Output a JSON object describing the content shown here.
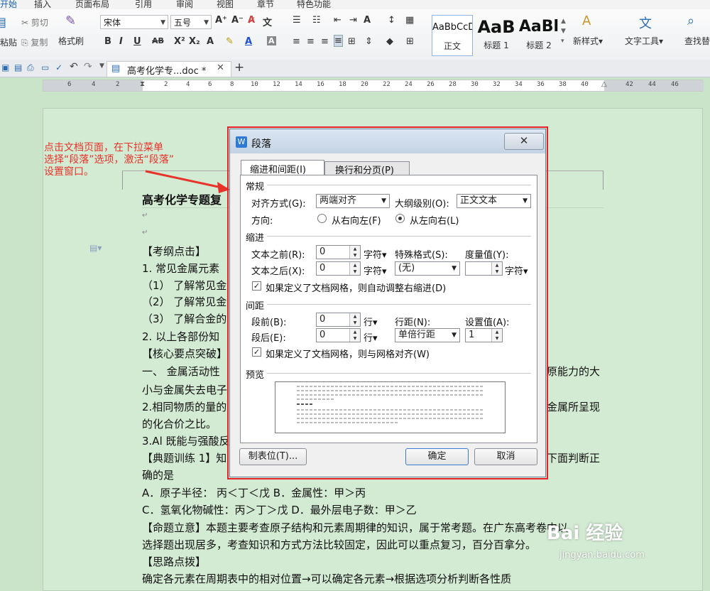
{
  "menu_tabs": [
    "开始",
    "插入",
    "页面布局",
    "引用",
    "审阅",
    "视图",
    "章节",
    "特色功能"
  ],
  "ribbon": {
    "paste": "粘贴",
    "cut": "剪切",
    "copy": "复制",
    "format_painter": "格式刷",
    "font": "宋体",
    "font_size": "五号",
    "style_previews": [
      {
        "preview": "AaBbCcDd",
        "label": "正文"
      },
      {
        "preview": "AaB",
        "label": "标题 1"
      },
      {
        "preview": "AaBl",
        "label": "标题 2"
      }
    ],
    "new_style": "新样式",
    "text_tools": "文字工具",
    "find": "查找替"
  },
  "doc_tab": {
    "title": "高考化学专...doc *"
  },
  "ruler_numbers": [
    "6",
    "4",
    "2",
    "2",
    "4",
    "6",
    "8",
    "10",
    "12",
    "14",
    "16",
    "18",
    "20",
    "22",
    "24",
    "26",
    "28",
    "30",
    "32",
    "34",
    "36",
    "38",
    "40",
    "42",
    "44",
    "46"
  ],
  "annotation": "点击文档页面，在下拉菜单\n选择“段落”选项，激活“段落”\n设置窗口。",
  "document_lines": [
    "高考化学专题复",
    "",
    "",
    "【考纲点击】",
    "1. 常见金属元素",
    "（1）  了解常见金",
    "（2）  了解常见金",
    "（3）  了解合金的",
    "2. 以上各部份知",
    "【核心要点突破】",
    "一、  金属活动性",
    "小与金属失去电子",
    "2.相同物质的量的",
    "的化合价之比。",
    "3.Al 既能与强酸反",
    "【典题训练 1】知",
    "确的是",
    "A．原子半径：  丙＜丁＜戊               B．金属性：甲＞丙",
    "C．氢氧化物碱性：丙＞丁＞戊             D．最外层电子数：甲＞乙",
    "【命题立意】本题主要考查原子结构和元素周期律的知识，属于常考题。在广东高考卷中以",
    "选择题出现居多，考查知识和方式方法比较固定，因此可以重点复习，百分百拿分。",
    "【思路点拨】",
    "    确定各元素在周期表中的相对位置→可以确定各元素→根据选项分析判断各性质"
  ],
  "right_fragments": [
    "原能力的大",
    "金属所呈现",
    "下面判断正"
  ],
  "dialog": {
    "title": "段落",
    "tabs": [
      "缩进和间距(I)",
      "换行和分页(P)"
    ],
    "sec_general": "常规",
    "align_label": "对齐方式(G):",
    "align_value": "两端对齐",
    "outline_label": "大纲级别(O):",
    "outline_value": "正文文本",
    "direction_label": "方向:",
    "dir_rtl": "从右向左(F)",
    "dir_ltr": "从左向右(L)",
    "sec_indent": "缩进",
    "before_text_label": "文本之前(R):",
    "before_text_value": "0",
    "unit_char": "字符",
    "special_label": "特殊格式(S):",
    "measure_label": "度量值(Y):",
    "after_text_label": "文本之后(X):",
    "after_text_value": "0",
    "special_value": "(无)",
    "grid_indent_check": "如果定义了文档网格，则自动调整右缩进(D)",
    "sec_spacing": "间距",
    "space_before_label": "段前(B):",
    "space_before_value": "0",
    "unit_line": "行",
    "line_spacing_label": "行距(N):",
    "setting_label": "设置值(A):",
    "space_after_label": "段后(E):",
    "space_after_value": "0",
    "line_spacing_value": "单倍行距",
    "setting_value": "1",
    "grid_align_check": "如果定义了文档网格，则与网格对齐(W)",
    "sec_preview": "预览",
    "tabs_button": "制表位(T)...",
    "ok": "确定",
    "cancel": "取消"
  },
  "watermark": "Bai 经验",
  "watermark_sub": "jingyan.baidu.com"
}
